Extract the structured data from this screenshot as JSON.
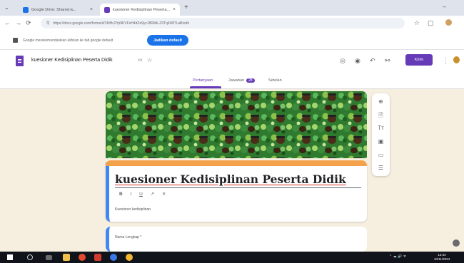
{
  "browser": {
    "tabs": [
      {
        "title": "Google Drive: Shared w...",
        "active": false,
        "favicon_color": "#1a73e8"
      },
      {
        "title": "kuesioner Kedisiplinan Peserta...",
        "active": true,
        "favicon_color": "#673ab7"
      }
    ],
    "new_tab_label": "+",
    "url": "https://docs.google.com/forms/d/1MHc2Yp9KVFsH4dZe9ycJ8RMk-Z9Tq4Wf7LaB/edit",
    "nav_icons": [
      "back-icon",
      "forward-icon",
      "reload-icon"
    ],
    "extension_icons": [
      "bookmark-icon",
      "extensions-icon",
      "profile-icon"
    ]
  },
  "infobar": {
    "text": "Google merekomendasikan alihkan ke tab google default",
    "button_label": "Jadikan default"
  },
  "form_header": {
    "doc_title": "kuesioner Kedisiplinan Peserta Didik",
    "send_label": "Kirim",
    "tabs": [
      {
        "label": "Pertanyaan",
        "active": true
      },
      {
        "label": "Jawaban",
        "count": "28",
        "active": false
      },
      {
        "label": "Setelan",
        "active": false
      }
    ],
    "accent_color": "#673ab7"
  },
  "form": {
    "title": "kuesioner Kedisiplinan Peserta Didik",
    "format_buttons": [
      "B",
      "I",
      "U",
      "↗",
      "✕"
    ],
    "description": "Kuesioner kedisiplinan",
    "question_label": "Nama Lengkap *"
  },
  "side_toolbar": {
    "icons": [
      "add-question-icon",
      "import-icon",
      "title-text-icon",
      "image-icon",
      "video-icon",
      "section-icon"
    ]
  },
  "taskbar": {
    "time": "13:44",
    "date": "10/11/2024"
  }
}
